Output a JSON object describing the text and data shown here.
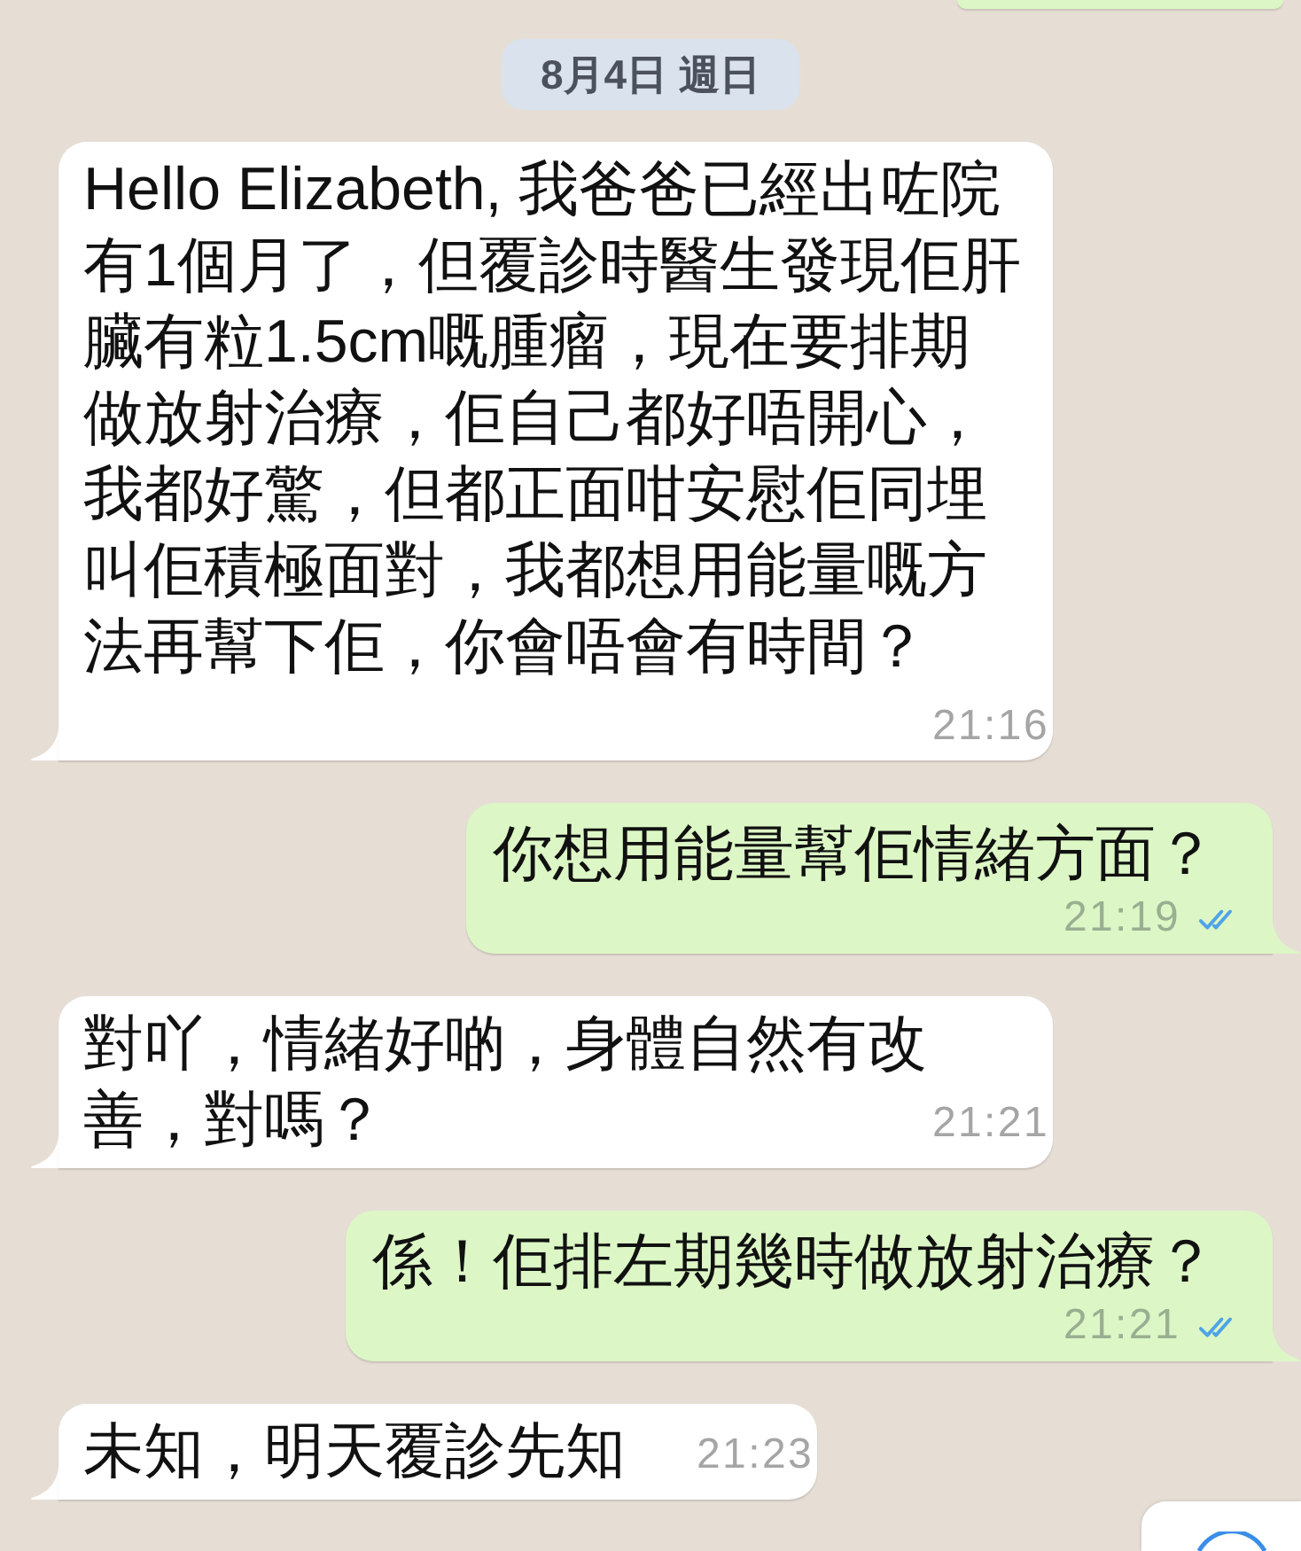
{
  "bubble_above": {
    "kind": "outgoing"
  },
  "date_separator": {
    "label": "8月4日 週日"
  },
  "messages": [
    {
      "kind": "incoming",
      "text": "Hello Elizabeth, 我爸爸已經出咗院有1個月了，但覆診時醫生發現佢肝臟有粒1.5cm嘅腫瘤，現在要排期做放射治療，佢自己都好唔開心，我都好驚，但都正面咁安慰佢同埋叫佢積極面對，我都想用能量嘅方法再幫下佢，你會唔會有時間？",
      "time": "21:16"
    },
    {
      "kind": "outgoing",
      "text": "你想用能量幫佢情緒方面？",
      "time": "21:19",
      "read": true
    },
    {
      "kind": "incoming",
      "text": "對吖，情緒好啲，身體自然有改善，對嗎？",
      "time": "21:21"
    },
    {
      "kind": "outgoing",
      "text": "係！佢排左期幾時做放射治療？",
      "time": "21:21",
      "read": true
    },
    {
      "kind": "incoming",
      "text": "未知，明天覆診先知",
      "time": "21:23"
    }
  ]
}
